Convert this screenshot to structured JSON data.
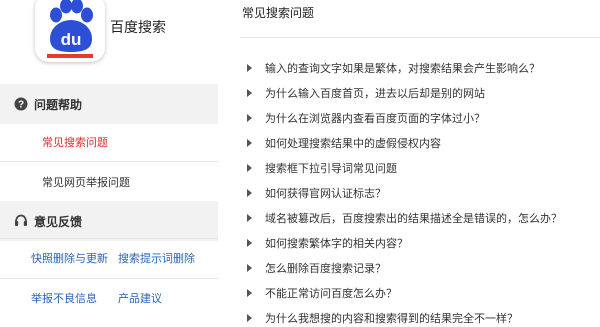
{
  "brand": {
    "name": "百度搜索",
    "logo_text": "du",
    "icon": "baidu-paw-logo"
  },
  "colors": {
    "accent_red": "#e02d2d",
    "link_blue": "#2a65b7",
    "logo_blue": "#2d4fd6",
    "logo_red": "#e33b2e"
  },
  "sidebar": {
    "help_section": {
      "icon": "question-circle-icon",
      "label": "问题帮助"
    },
    "help_items": [
      {
        "label": "常见搜索问题",
        "active": true
      },
      {
        "label": "常见网页举报问题",
        "active": false
      }
    ],
    "feedback_section": {
      "icon": "headset-icon",
      "label": "意见反馈"
    },
    "feedback_links": [
      {
        "label": "快照删除与更新"
      },
      {
        "label": "搜索提示词删除"
      },
      {
        "label": "举报不良信息"
      },
      {
        "label": "产品建议"
      }
    ]
  },
  "main": {
    "title": "常见搜索问题",
    "questions": [
      "输入的查询文字如果是繁体，对搜索结果会产生影响么？",
      "为什么输入百度首页，进去以后却是别的网站",
      "为什么在浏览器内查看百度页面的字体过小？",
      "如何处理搜索结果中的虚假侵权内容",
      "搜索框下拉引导词常见问题",
      "如何获得官网认证标志？",
      "域名被篡改后，百度搜索出的结果描述全是错误的，怎么办？",
      "如何搜索繁体字的相关内容？",
      "怎么删除百度搜索记录？",
      "不能正常访问百度怎么办？",
      "为什么我想搜的内容和搜索得到的结果完全不一样？"
    ]
  }
}
